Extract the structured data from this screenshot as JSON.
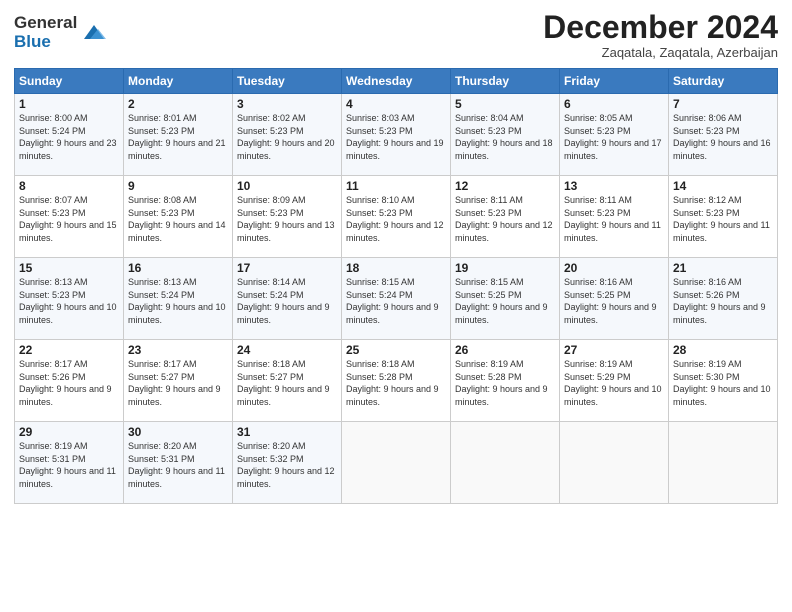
{
  "logo": {
    "text_general": "General",
    "text_blue": "Blue"
  },
  "header": {
    "month": "December 2024",
    "location": "Zaqatala, Zaqatala, Azerbaijan"
  },
  "weekdays": [
    "Sunday",
    "Monday",
    "Tuesday",
    "Wednesday",
    "Thursday",
    "Friday",
    "Saturday"
  ],
  "weeks": [
    [
      {
        "day": "1",
        "sunrise": "Sunrise: 8:00 AM",
        "sunset": "Sunset: 5:24 PM",
        "daylight": "Daylight: 9 hours and 23 minutes."
      },
      {
        "day": "2",
        "sunrise": "Sunrise: 8:01 AM",
        "sunset": "Sunset: 5:23 PM",
        "daylight": "Daylight: 9 hours and 21 minutes."
      },
      {
        "day": "3",
        "sunrise": "Sunrise: 8:02 AM",
        "sunset": "Sunset: 5:23 PM",
        "daylight": "Daylight: 9 hours and 20 minutes."
      },
      {
        "day": "4",
        "sunrise": "Sunrise: 8:03 AM",
        "sunset": "Sunset: 5:23 PM",
        "daylight": "Daylight: 9 hours and 19 minutes."
      },
      {
        "day": "5",
        "sunrise": "Sunrise: 8:04 AM",
        "sunset": "Sunset: 5:23 PM",
        "daylight": "Daylight: 9 hours and 18 minutes."
      },
      {
        "day": "6",
        "sunrise": "Sunrise: 8:05 AM",
        "sunset": "Sunset: 5:23 PM",
        "daylight": "Daylight: 9 hours and 17 minutes."
      },
      {
        "day": "7",
        "sunrise": "Sunrise: 8:06 AM",
        "sunset": "Sunset: 5:23 PM",
        "daylight": "Daylight: 9 hours and 16 minutes."
      }
    ],
    [
      {
        "day": "8",
        "sunrise": "Sunrise: 8:07 AM",
        "sunset": "Sunset: 5:23 PM",
        "daylight": "Daylight: 9 hours and 15 minutes."
      },
      {
        "day": "9",
        "sunrise": "Sunrise: 8:08 AM",
        "sunset": "Sunset: 5:23 PM",
        "daylight": "Daylight: 9 hours and 14 minutes."
      },
      {
        "day": "10",
        "sunrise": "Sunrise: 8:09 AM",
        "sunset": "Sunset: 5:23 PM",
        "daylight": "Daylight: 9 hours and 13 minutes."
      },
      {
        "day": "11",
        "sunrise": "Sunrise: 8:10 AM",
        "sunset": "Sunset: 5:23 PM",
        "daylight": "Daylight: 9 hours and 12 minutes."
      },
      {
        "day": "12",
        "sunrise": "Sunrise: 8:11 AM",
        "sunset": "Sunset: 5:23 PM",
        "daylight": "Daylight: 9 hours and 12 minutes."
      },
      {
        "day": "13",
        "sunrise": "Sunrise: 8:11 AM",
        "sunset": "Sunset: 5:23 PM",
        "daylight": "Daylight: 9 hours and 11 minutes."
      },
      {
        "day": "14",
        "sunrise": "Sunrise: 8:12 AM",
        "sunset": "Sunset: 5:23 PM",
        "daylight": "Daylight: 9 hours and 11 minutes."
      }
    ],
    [
      {
        "day": "15",
        "sunrise": "Sunrise: 8:13 AM",
        "sunset": "Sunset: 5:23 PM",
        "daylight": "Daylight: 9 hours and 10 minutes."
      },
      {
        "day": "16",
        "sunrise": "Sunrise: 8:13 AM",
        "sunset": "Sunset: 5:24 PM",
        "daylight": "Daylight: 9 hours and 10 minutes."
      },
      {
        "day": "17",
        "sunrise": "Sunrise: 8:14 AM",
        "sunset": "Sunset: 5:24 PM",
        "daylight": "Daylight: 9 hours and 9 minutes."
      },
      {
        "day": "18",
        "sunrise": "Sunrise: 8:15 AM",
        "sunset": "Sunset: 5:24 PM",
        "daylight": "Daylight: 9 hours and 9 minutes."
      },
      {
        "day": "19",
        "sunrise": "Sunrise: 8:15 AM",
        "sunset": "Sunset: 5:25 PM",
        "daylight": "Daylight: 9 hours and 9 minutes."
      },
      {
        "day": "20",
        "sunrise": "Sunrise: 8:16 AM",
        "sunset": "Sunset: 5:25 PM",
        "daylight": "Daylight: 9 hours and 9 minutes."
      },
      {
        "day": "21",
        "sunrise": "Sunrise: 8:16 AM",
        "sunset": "Sunset: 5:26 PM",
        "daylight": "Daylight: 9 hours and 9 minutes."
      }
    ],
    [
      {
        "day": "22",
        "sunrise": "Sunrise: 8:17 AM",
        "sunset": "Sunset: 5:26 PM",
        "daylight": "Daylight: 9 hours and 9 minutes."
      },
      {
        "day": "23",
        "sunrise": "Sunrise: 8:17 AM",
        "sunset": "Sunset: 5:27 PM",
        "daylight": "Daylight: 9 hours and 9 minutes."
      },
      {
        "day": "24",
        "sunrise": "Sunrise: 8:18 AM",
        "sunset": "Sunset: 5:27 PM",
        "daylight": "Daylight: 9 hours and 9 minutes."
      },
      {
        "day": "25",
        "sunrise": "Sunrise: 8:18 AM",
        "sunset": "Sunset: 5:28 PM",
        "daylight": "Daylight: 9 hours and 9 minutes."
      },
      {
        "day": "26",
        "sunrise": "Sunrise: 8:19 AM",
        "sunset": "Sunset: 5:28 PM",
        "daylight": "Daylight: 9 hours and 9 minutes."
      },
      {
        "day": "27",
        "sunrise": "Sunrise: 8:19 AM",
        "sunset": "Sunset: 5:29 PM",
        "daylight": "Daylight: 9 hours and 10 minutes."
      },
      {
        "day": "28",
        "sunrise": "Sunrise: 8:19 AM",
        "sunset": "Sunset: 5:30 PM",
        "daylight": "Daylight: 9 hours and 10 minutes."
      }
    ],
    [
      {
        "day": "29",
        "sunrise": "Sunrise: 8:19 AM",
        "sunset": "Sunset: 5:31 PM",
        "daylight": "Daylight: 9 hours and 11 minutes."
      },
      {
        "day": "30",
        "sunrise": "Sunrise: 8:20 AM",
        "sunset": "Sunset: 5:31 PM",
        "daylight": "Daylight: 9 hours and 11 minutes."
      },
      {
        "day": "31",
        "sunrise": "Sunrise: 8:20 AM",
        "sunset": "Sunset: 5:32 PM",
        "daylight": "Daylight: 9 hours and 12 minutes."
      },
      null,
      null,
      null,
      null
    ]
  ]
}
